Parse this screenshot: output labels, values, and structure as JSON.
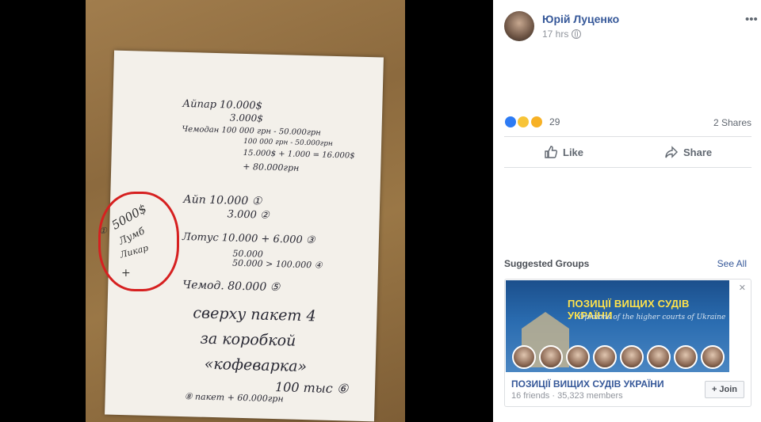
{
  "photo": {
    "note_lines": [
      "Айпар 10.000$",
      "3.000$",
      "Чемодан 100 000 грн - 50.000грн",
      "100 000 грн - 50.000грн",
      "15.000$ + 1.000 = 16.000$",
      "+ 80.000грн",
      "Айп 10.000 ①",
      "3.000 ②",
      "Лотус 10.000 + 6.000 ③",
      "50.000",
      "50.000 > 100.000 ④",
      "Чемод. 80.000 ⑤",
      "сверху пакет 4",
      "за коробкой",
      "«кофеварка»",
      "100 тыс ⑥",
      "⑧ пакет + 60.000грн"
    ],
    "circled_note": [
      "①",
      "5000$",
      "Лумб",
      "Ликар",
      "+"
    ]
  },
  "post": {
    "author": "Юрій Луценко",
    "time": "17 hrs",
    "reactions_count": "29",
    "shares": "2 Shares",
    "like_label": "Like",
    "share_label": "Share"
  },
  "suggested": {
    "heading": "Suggested Groups",
    "see_all": "See All",
    "banner_title": "ПОЗИЦІЇ ВИЩИХ СУДІВ УКРАЇНИ",
    "banner_subtitle": "Opinions of the higher courts of Ukraine",
    "group_name": "ПОЗИЦІЇ ВИЩИХ СУДІВ УКРАЇНИ",
    "group_meta": "16 friends · 35,323 members",
    "join_label": "Join"
  },
  "icons": {
    "menu": "more-menu-icon",
    "privacy": "globe-icon",
    "reactions": [
      "like-reaction-icon",
      "wow-reaction-icon",
      "haha-reaction-icon"
    ],
    "close": "close-icon"
  },
  "colors": {
    "link": "#365899",
    "annotation": "#d62020"
  }
}
